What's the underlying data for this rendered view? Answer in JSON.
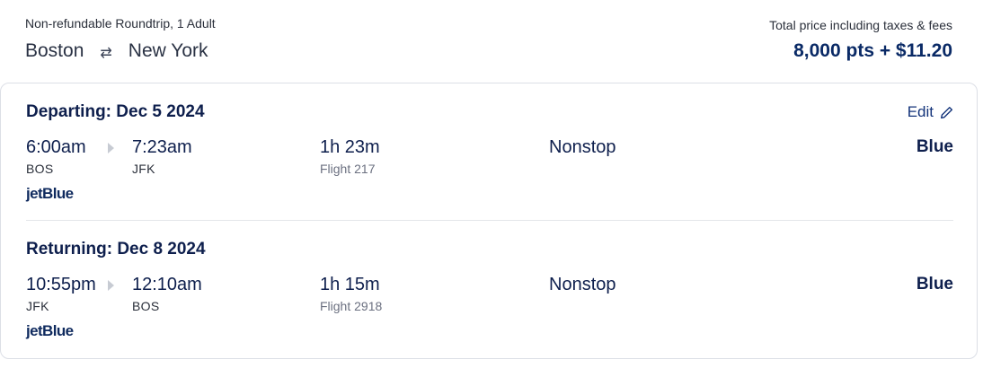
{
  "header": {
    "fare_type": "Non-refundable Roundtrip, 1 Adult",
    "origin": "Boston",
    "swap_icon": "swap-arrows-icon",
    "destination": "New York",
    "total_label": "Total price including taxes & fees",
    "total_price": "8,000 pts + $11.20"
  },
  "segments": [
    {
      "title": "Departing: Dec 5 2024",
      "edit_label": "Edit",
      "edit_icon": "pencil-icon",
      "depart_time": "6:00am",
      "depart_code": "BOS",
      "arrive_time": "7:23am",
      "arrive_code": "JFK",
      "duration": "1h 23m",
      "flight_number": "Flight 217",
      "stops": "Nonstop",
      "cabin": "Blue",
      "airline": "jetBlue"
    },
    {
      "title": "Returning: Dec 8 2024",
      "depart_time": "10:55pm",
      "depart_code": "JFK",
      "arrive_time": "12:10am",
      "arrive_code": "BOS",
      "duration": "1h 15m",
      "flight_number": "Flight 2918",
      "stops": "Nonstop",
      "cabin": "Blue",
      "airline": "jetBlue"
    }
  ],
  "colors": {
    "navy": "#0e1f4d",
    "price": "#0a2a66",
    "link": "#13337a",
    "border": "#dcdfe6"
  }
}
